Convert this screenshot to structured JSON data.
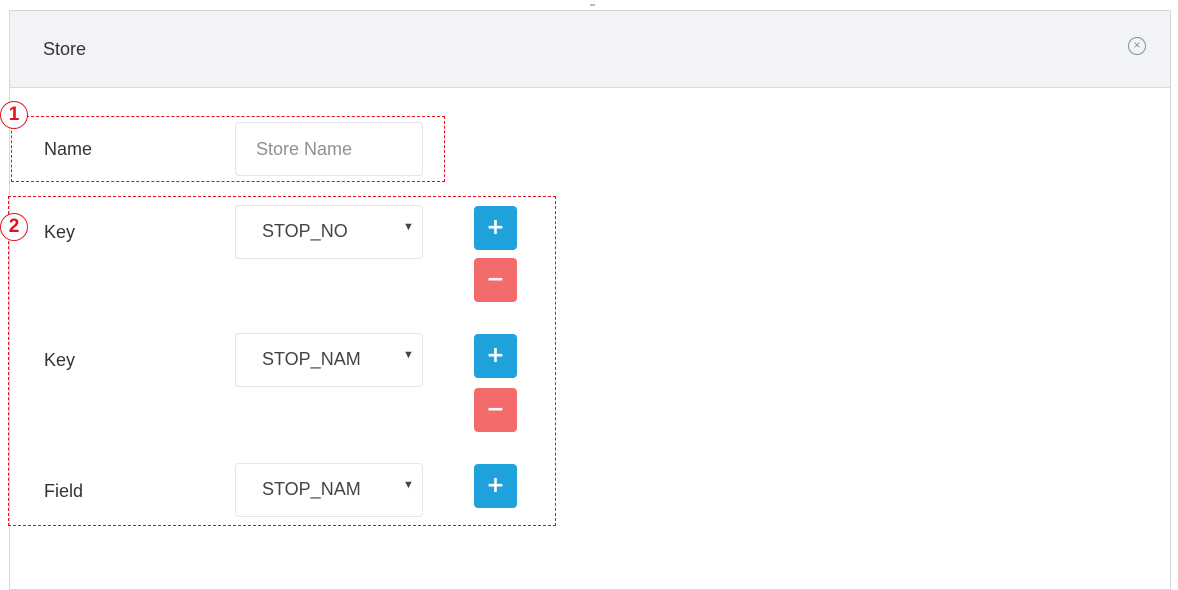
{
  "panel": {
    "title": "Store",
    "close_icon": "close-circle-icon"
  },
  "form": {
    "name_label": "Name",
    "name_placeholder": "Store Name",
    "rows": [
      {
        "label": "Key",
        "selected": "STOP_NO"
      },
      {
        "label": "Key",
        "selected": "STOP_NAM"
      },
      {
        "label": "Field",
        "selected": "STOP_NAM"
      }
    ],
    "add_symbol": "+",
    "remove_symbol": "−",
    "caret_symbol": "▼",
    "close_symbol": "×"
  },
  "annotations": {
    "marker_1": "1",
    "marker_2": "2"
  },
  "colors": {
    "add_button": "#1fa2dc",
    "remove_button": "#f36b6b",
    "annotation": "#e1111b",
    "header_bg": "#f1f3f6"
  }
}
